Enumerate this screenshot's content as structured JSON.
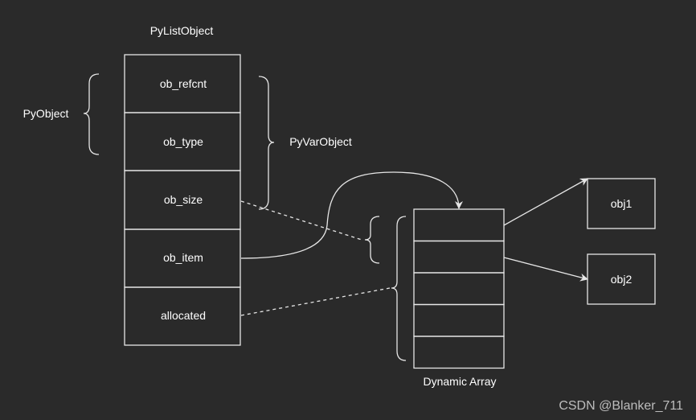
{
  "title": "PyListObject",
  "fields": [
    "ob_refcnt",
    "ob_type",
    "ob_size",
    "ob_item",
    "allocated"
  ],
  "brace_labels": {
    "pyobject": "PyObject",
    "pyvarobject": "PyVarObject"
  },
  "array_label": "Dynamic Array",
  "array_cells": 5,
  "objects": [
    "obj1",
    "obj2"
  ],
  "watermark": "CSDN @Blanker_711",
  "colors": {
    "background": "#2a2a2a",
    "stroke": "#e6e6e6",
    "text": "#ffffff"
  }
}
